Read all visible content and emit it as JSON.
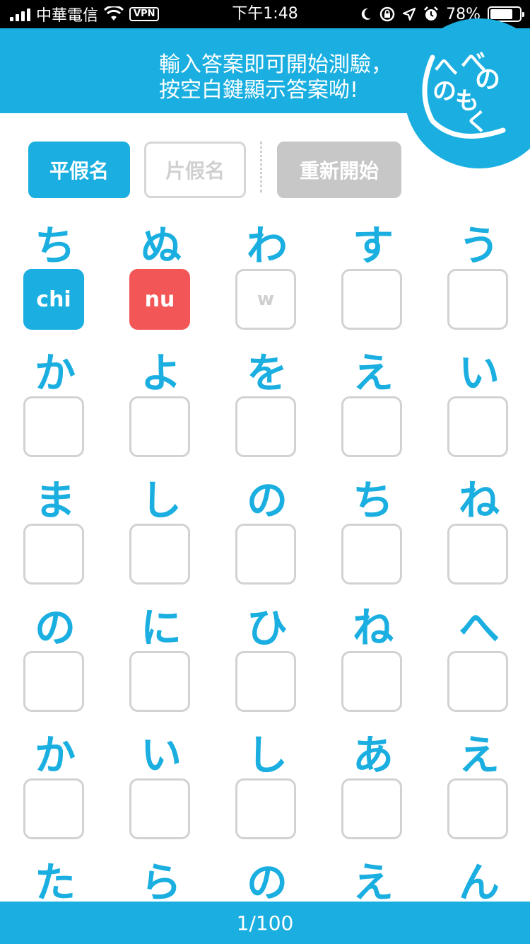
{
  "status_bar": {
    "carrier": "中華電信",
    "vpn": "VPN",
    "time": "下午1:48",
    "battery": "78%",
    "battery_level": 0.78
  },
  "header": {
    "line1": "輸入答案即可開始測驗，",
    "line2": "按空白鍵顯示答案呦!",
    "logo_text": [
      "へ",
      "の",
      "べ",
      "の",
      "も",
      "く"
    ]
  },
  "buttons": {
    "hiragana": "平假名",
    "katakana": "片假名",
    "restart": "重新開始"
  },
  "grid": [
    [
      "ち",
      "ぬ",
      "わ",
      "す",
      "う"
    ],
    [
      "か",
      "よ",
      "を",
      "え",
      "い"
    ],
    [
      "ま",
      "し",
      "の",
      "ち",
      "ね"
    ],
    [
      "の",
      "に",
      "ひ",
      "ね",
      "へ"
    ],
    [
      "か",
      "い",
      "し",
      "あ",
      "え"
    ],
    [
      "た",
      "ら",
      "の",
      "え",
      "ん"
    ]
  ],
  "answers": [
    [
      "chi",
      "nu",
      "w",
      "",
      ""
    ]
  ],
  "answer_states": [
    [
      "correct",
      "wrong",
      "typing",
      "empty",
      "empty"
    ]
  ],
  "footer": {
    "progress": "1/100"
  },
  "colors": {
    "accent": "#1aafe0",
    "wrong": "#f35656",
    "restart_gray": "#c7c7c7"
  }
}
